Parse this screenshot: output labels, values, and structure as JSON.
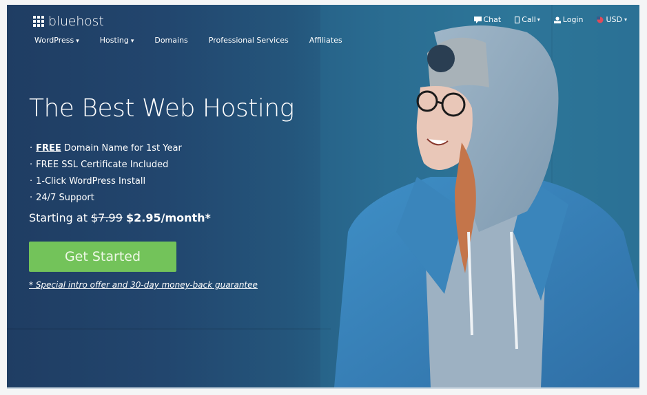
{
  "brand": {
    "name": "bluehost"
  },
  "nav": {
    "items": [
      {
        "label": "WordPress",
        "has_dropdown": true
      },
      {
        "label": "Hosting",
        "has_dropdown": true
      },
      {
        "label": "Domains",
        "has_dropdown": false
      },
      {
        "label": "Professional Services",
        "has_dropdown": false
      },
      {
        "label": "Affiliates",
        "has_dropdown": false
      }
    ]
  },
  "utility": {
    "chat": {
      "label": "Chat",
      "icon": "chat-icon"
    },
    "call": {
      "label": "Call",
      "icon": "phone-icon"
    },
    "login": {
      "label": "Login",
      "icon": "user-icon"
    },
    "currency": {
      "label": "USD",
      "icon": "flag-icon"
    }
  },
  "hero": {
    "headline": "The Best Web Hosting",
    "features": [
      {
        "bullet": "·",
        "emphasis": "FREE",
        "text": " Domain Name for 1st Year"
      },
      {
        "bullet": "·",
        "emphasis": "",
        "text": "FREE SSL Certificate Included"
      },
      {
        "bullet": "·",
        "emphasis": "",
        "text": "1-Click WordPress Install"
      },
      {
        "bullet": "·",
        "emphasis": "",
        "text": "24/7 Support"
      }
    ],
    "price": {
      "prefix": "Starting at ",
      "old": "$7.99",
      "new": "$2.95/month*"
    },
    "cta_label": "Get Started",
    "disclaimer": "* Special intro offer and 30-day money-back guarantee"
  },
  "colors": {
    "cta": "#73c35a",
    "hero_dark": "#1f3d63",
    "hero_light": "#2f7899"
  },
  "caret": "▾"
}
